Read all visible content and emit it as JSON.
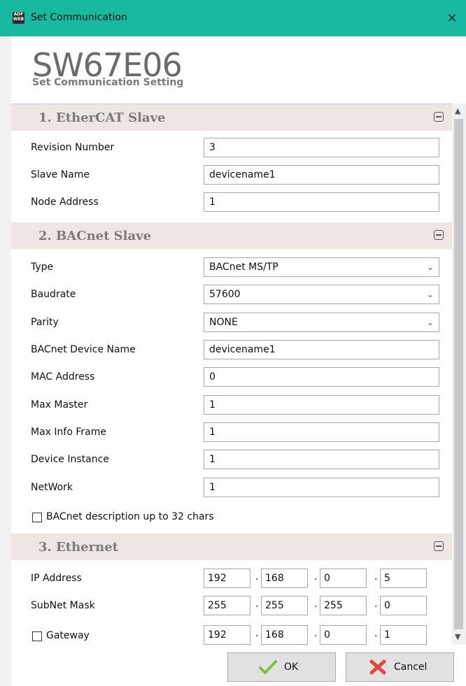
{
  "window": {
    "title": "Set Communication",
    "close_glyph": "×",
    "app_icon_text": "ADF WEB"
  },
  "header": {
    "title": "SW67E06",
    "subtitle": "Set Communication Setting"
  },
  "sections": {
    "ethercat": {
      "title": "1. EtherCAT Slave",
      "revision_label": "Revision Number",
      "revision_value": "3",
      "slave_name_label": "Slave Name",
      "slave_name_value": "devicename1",
      "node_address_label": "Node Address",
      "node_address_value": "1"
    },
    "bacnet": {
      "title": "2. BACnet Slave",
      "type_label": "Type",
      "type_value": "BACnet MS/TP",
      "baudrate_label": "Baudrate",
      "baudrate_value": "57600",
      "parity_label": "Parity",
      "parity_value": "NONE",
      "device_name_label": "BACnet Device Name",
      "device_name_value": "devicename1",
      "mac_label": "MAC Address",
      "mac_value": "0",
      "max_master_label": "Max Master",
      "max_master_value": "1",
      "max_info_label": "Max Info Frame",
      "max_info_value": "1",
      "device_instance_label": "Device Instance",
      "device_instance_value": "1",
      "network_label": "NetWork",
      "network_value": "1",
      "desc32_label": "BACnet description up to 32 chars",
      "desc32_checked": false
    },
    "ethernet": {
      "title": "3. Ethernet",
      "ip_label": "IP Address",
      "ip": [
        "192",
        "168",
        "0",
        "5"
      ],
      "subnet_label": "SubNet Mask",
      "subnet": [
        "255",
        "255",
        "255",
        "0"
      ],
      "gateway_label": "Gateway",
      "gateway_checked": false,
      "gateway": [
        "192",
        "168",
        "0",
        "1"
      ],
      "dot": "."
    }
  },
  "buttons": {
    "ok_label": "OK",
    "cancel_label": "Cancel"
  },
  "colors": {
    "titlebar": "#18b9a0",
    "section_bg": "#efe6e4",
    "ok_check": "#7ac142",
    "cancel_x": "#e0443a"
  },
  "icons": {
    "chevron": "chevron-down-icon",
    "collapse": "collapse-minus-icon",
    "ok": "check-icon",
    "cancel": "x-icon"
  }
}
